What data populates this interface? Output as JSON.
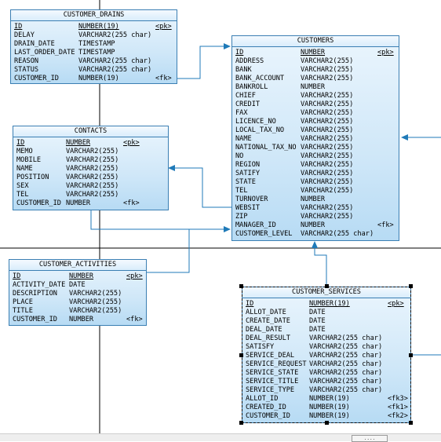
{
  "entities": {
    "customer_drains": {
      "title": "CUSTOMER_DRAINS",
      "columns": [
        {
          "name": "ID",
          "type": "NUMBER(19)",
          "key": "<pk>",
          "underline": true
        },
        {
          "name": "DELAY",
          "type": "VARCHAR2(255 char)",
          "key": ""
        },
        {
          "name": "DRAIN_DATE",
          "type": "TIMESTAMP",
          "key": ""
        },
        {
          "name": "LAST_ORDER_DATE",
          "type": "TIMESTAMP",
          "key": ""
        },
        {
          "name": "REASON",
          "type": "VARCHAR2(255 char)",
          "key": ""
        },
        {
          "name": "STATUS",
          "type": "VARCHAR2(255 char)",
          "key": ""
        },
        {
          "name": "CUSTOMER_ID",
          "type": "NUMBER(19)",
          "key": "<fk>"
        }
      ]
    },
    "customers": {
      "title": "CUSTOMERS",
      "columns": [
        {
          "name": "ID",
          "type": "NUMBER",
          "key": "<pk>",
          "underline": true
        },
        {
          "name": "ADDRESS",
          "type": "VARCHAR2(255)",
          "key": ""
        },
        {
          "name": "BANK",
          "type": "VARCHAR2(255)",
          "key": ""
        },
        {
          "name": "BANK_ACCOUNT",
          "type": "VARCHAR2(255)",
          "key": ""
        },
        {
          "name": "BANKROLL",
          "type": "NUMBER",
          "key": ""
        },
        {
          "name": "CHIEF",
          "type": "VARCHAR2(255)",
          "key": ""
        },
        {
          "name": "CREDIT",
          "type": "VARCHAR2(255)",
          "key": ""
        },
        {
          "name": "FAX",
          "type": "VARCHAR2(255)",
          "key": ""
        },
        {
          "name": "LICENCE_NO",
          "type": "VARCHAR2(255)",
          "key": ""
        },
        {
          "name": "LOCAL_TAX_NO",
          "type": "VARCHAR2(255)",
          "key": ""
        },
        {
          "name": "NAME",
          "type": "VARCHAR2(255)",
          "key": ""
        },
        {
          "name": "NATIONAL_TAX_NO",
          "type": "VARCHAR2(255)",
          "key": ""
        },
        {
          "name": "NO",
          "type": "VARCHAR2(255)",
          "key": ""
        },
        {
          "name": "REGION",
          "type": "VARCHAR2(255)",
          "key": ""
        },
        {
          "name": "SATIFY",
          "type": "VARCHAR2(255)",
          "key": ""
        },
        {
          "name": "STATE",
          "type": "VARCHAR2(255)",
          "key": ""
        },
        {
          "name": "TEL",
          "type": "VARCHAR2(255)",
          "key": ""
        },
        {
          "name": "TURNOVER",
          "type": "NUMBER",
          "key": ""
        },
        {
          "name": "WEBSIT",
          "type": "VARCHAR2(255)",
          "key": ""
        },
        {
          "name": "ZIP",
          "type": "VARCHAR2(255)",
          "key": ""
        },
        {
          "name": "MANAGER_ID",
          "type": "NUMBER",
          "key": "<fk>"
        },
        {
          "name": "CUSTOMER_LEVEL",
          "type": "VARCHAR2(255 char)",
          "key": ""
        }
      ]
    },
    "contacts": {
      "title": "CONTACTS",
      "columns": [
        {
          "name": "ID",
          "type": "NUMBER",
          "key": "<pk>",
          "underline": true
        },
        {
          "name": "MEMO",
          "type": "VARCHAR2(255)",
          "key": ""
        },
        {
          "name": "MOBILE",
          "type": "VARCHAR2(255)",
          "key": ""
        },
        {
          "name": "NAME",
          "type": "VARCHAR2(255)",
          "key": ""
        },
        {
          "name": "POSITION",
          "type": "VARCHAR2(255)",
          "key": ""
        },
        {
          "name": "SEX",
          "type": "VARCHAR2(255)",
          "key": ""
        },
        {
          "name": "TEL",
          "type": "VARCHAR2(255)",
          "key": ""
        },
        {
          "name": "CUSTOMER_ID",
          "type": "NUMBER",
          "key": "<fk>"
        }
      ]
    },
    "customer_activities": {
      "title": "CUSTOMER_ACTIVITIES",
      "columns": [
        {
          "name": "ID",
          "type": "NUMBER",
          "key": "<pk>",
          "underline": true
        },
        {
          "name": "ACTIVITY_DATE",
          "type": "DATE",
          "key": ""
        },
        {
          "name": "DESCRIPTION",
          "type": "VARCHAR2(255)",
          "key": ""
        },
        {
          "name": "PLACE",
          "type": "VARCHAR2(255)",
          "key": ""
        },
        {
          "name": "TITLE",
          "type": "VARCHAR2(255)",
          "key": ""
        },
        {
          "name": "CUSTOMER_ID",
          "type": "NUMBER",
          "key": "<fk>"
        }
      ]
    },
    "customer_services": {
      "title": "CUSTOMER_SERVICES",
      "columns": [
        {
          "name": "ID",
          "type": "NUMBER(19)",
          "key": "<pk>",
          "underline": true
        },
        {
          "name": "ALLOT_DATE",
          "type": "DATE",
          "key": ""
        },
        {
          "name": "CREATE_DATE",
          "type": "DATE",
          "key": ""
        },
        {
          "name": "DEAL_DATE",
          "type": "DATE",
          "key": ""
        },
        {
          "name": "DEAL_RESULT",
          "type": "VARCHAR2(255 char)",
          "key": ""
        },
        {
          "name": "SATISFY",
          "type": "VARCHAR2(255 char)",
          "key": ""
        },
        {
          "name": "SERVICE_DEAL",
          "type": "VARCHAR2(255 char)",
          "key": ""
        },
        {
          "name": "SERVICE_REQUEST",
          "type": "VARCHAR2(255 char)",
          "key": ""
        },
        {
          "name": "SERVICE_STATE",
          "type": "VARCHAR2(255 char)",
          "key": ""
        },
        {
          "name": "SERVICE_TITLE",
          "type": "VARCHAR2(255 char)",
          "key": ""
        },
        {
          "name": "SERVICE_TYPE",
          "type": "VARCHAR2(255 char)",
          "key": ""
        },
        {
          "name": "ALLOT_ID",
          "type": "NUMBER(19)",
          "key": "<fk3>"
        },
        {
          "name": "CREATED_ID",
          "type": "NUMBER(19)",
          "key": "<fk1>"
        },
        {
          "name": "CUSTOMER_ID",
          "type": "NUMBER(19)",
          "key": "<fk2>"
        }
      ]
    }
  },
  "status_button": "....",
  "colors": {
    "line": "#1f7ab8",
    "border": "#3b7fb3",
    "grid": "#000000"
  }
}
